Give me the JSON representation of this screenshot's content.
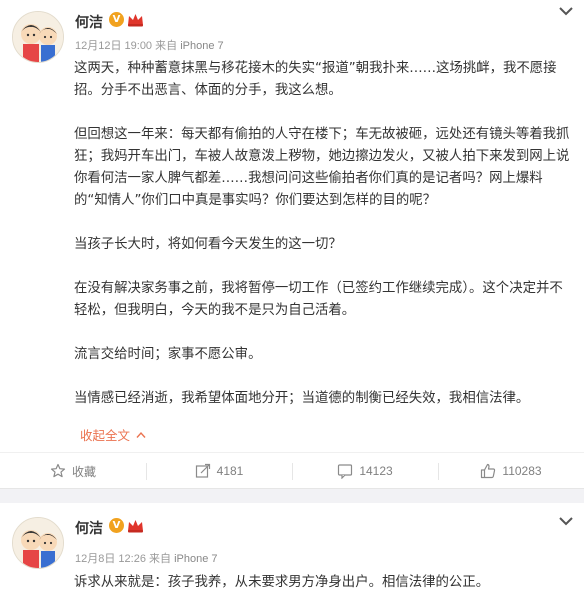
{
  "colors": {
    "accent": "#eb7350",
    "verified": "#f1a21f",
    "member": "#e0352b"
  },
  "posts": [
    {
      "author": "何洁",
      "timestamp": "12月12日 19:00",
      "via": "来自",
      "device": "iPhone 7",
      "paragraphs": [
        "这两天，种种蓄意抹黑与移花接木的失实“报道”朝我扑来……这场挑衅，我不愿接招。分手不出恶言、体面的分手，我这么想。",
        "但回想这一年来：每天都有偷拍的人守在楼下；车无故被砸，远处还有镜头等着我抓狂；我妈开车出门，车被人故意泼上秽物，她边擦边发火，又被人拍下来发到网上说你看何洁一家人脾气都差……我想问问这些偷拍者你们真的是记者吗？网上爆料的“知情人”你们口中真是事实吗？你们要达到怎样的目的呢？",
        "当孩子长大时，将如何看今天发生的这一切？",
        "在没有解决家务事之前，我将暂停一切工作（已签约工作继续完成）。这个决定并不轻松，但我明白，今天的我不是只为自己活着。",
        "流言交给时间；家事不愿公审。",
        "当情感已经消逝，我希望体面地分开；当道德的制衡已经失效，我相信法律。"
      ],
      "collapse_label": "收起全文",
      "actions": {
        "favorite_label": "收藏",
        "repost_count": "4181",
        "comment_count": "14123",
        "like_count": "110283"
      }
    },
    {
      "author": "何洁",
      "timestamp": "12月8日 12:26",
      "via": "来自",
      "device": "iPhone 7",
      "paragraphs": [
        "诉求从来就是：孩子我养，从未要求男方净身出户。相信法律的公正。"
      ]
    }
  ]
}
